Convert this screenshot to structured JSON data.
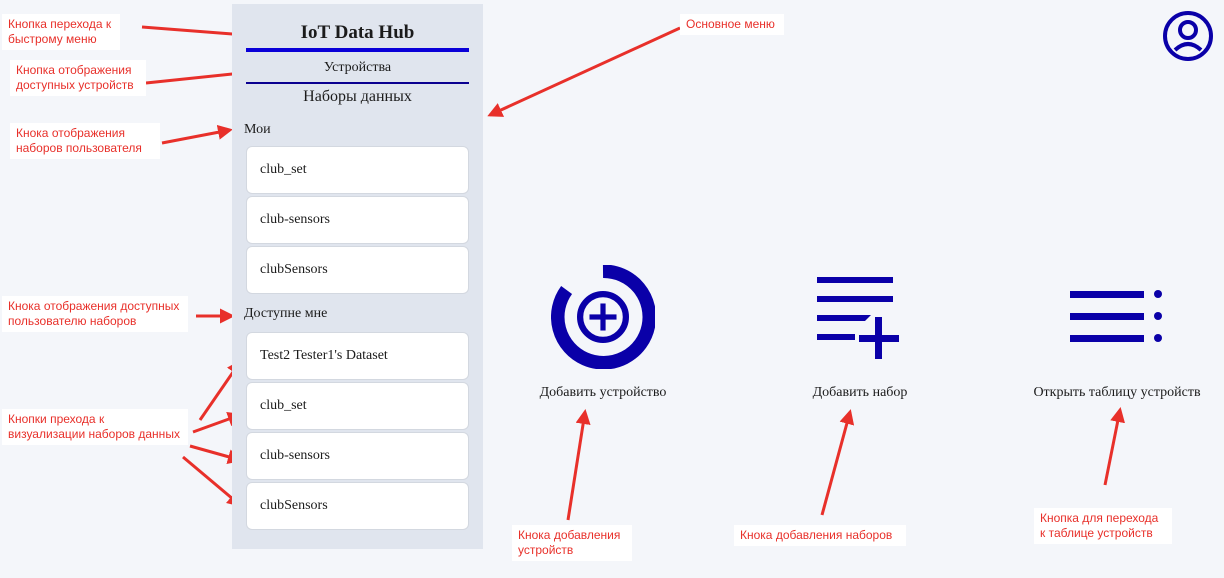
{
  "app": {
    "title": "IoT Data Hub"
  },
  "nav": {
    "devices": "Устройства",
    "datasets": "Наборы данных"
  },
  "my_section": {
    "title": "Мои",
    "items": [
      {
        "label": "club_set"
      },
      {
        "label": "club-sensors"
      },
      {
        "label": "clubSensors"
      }
    ]
  },
  "shared_section": {
    "title": "Доступне мне",
    "items": [
      {
        "label": "Test2 Tester1's Dataset"
      },
      {
        "label": "club_set"
      },
      {
        "label": "club-sensors"
      },
      {
        "label": "clubSensors"
      }
    ]
  },
  "actions": {
    "add_device": "Добавить устройство",
    "add_dataset": "Добавить набор",
    "open_devices_table": "Открыть таблицу устройств"
  },
  "annotations": {
    "quick_menu": "Кнопка перехода к\nбыстрому меню",
    "devices_btn": "Кнопка отображения\nдоступных устройств",
    "my_sets": "Кнока отображения\nнаборов пользователя",
    "main_menu": "Основное меню",
    "shared_sets": "Кнока отображения доступных\nпользователю наборов",
    "visualize": "Кнопки прехода к\nвизуализации наборов данных",
    "add_device": "Кнока добавления\nустройств",
    "add_dataset": "Кнока добавления наборов",
    "devices_table": "Кнопка для перехода\nк таблице устройств"
  },
  "colors": {
    "accent": "#0a00a8",
    "annotation": "#e8302a",
    "sidebar_bg": "#e0e5ee"
  },
  "icons": [
    "user-circle-icon",
    "add-circle-icon",
    "playlist-add-icon",
    "list-menu-icon"
  ]
}
